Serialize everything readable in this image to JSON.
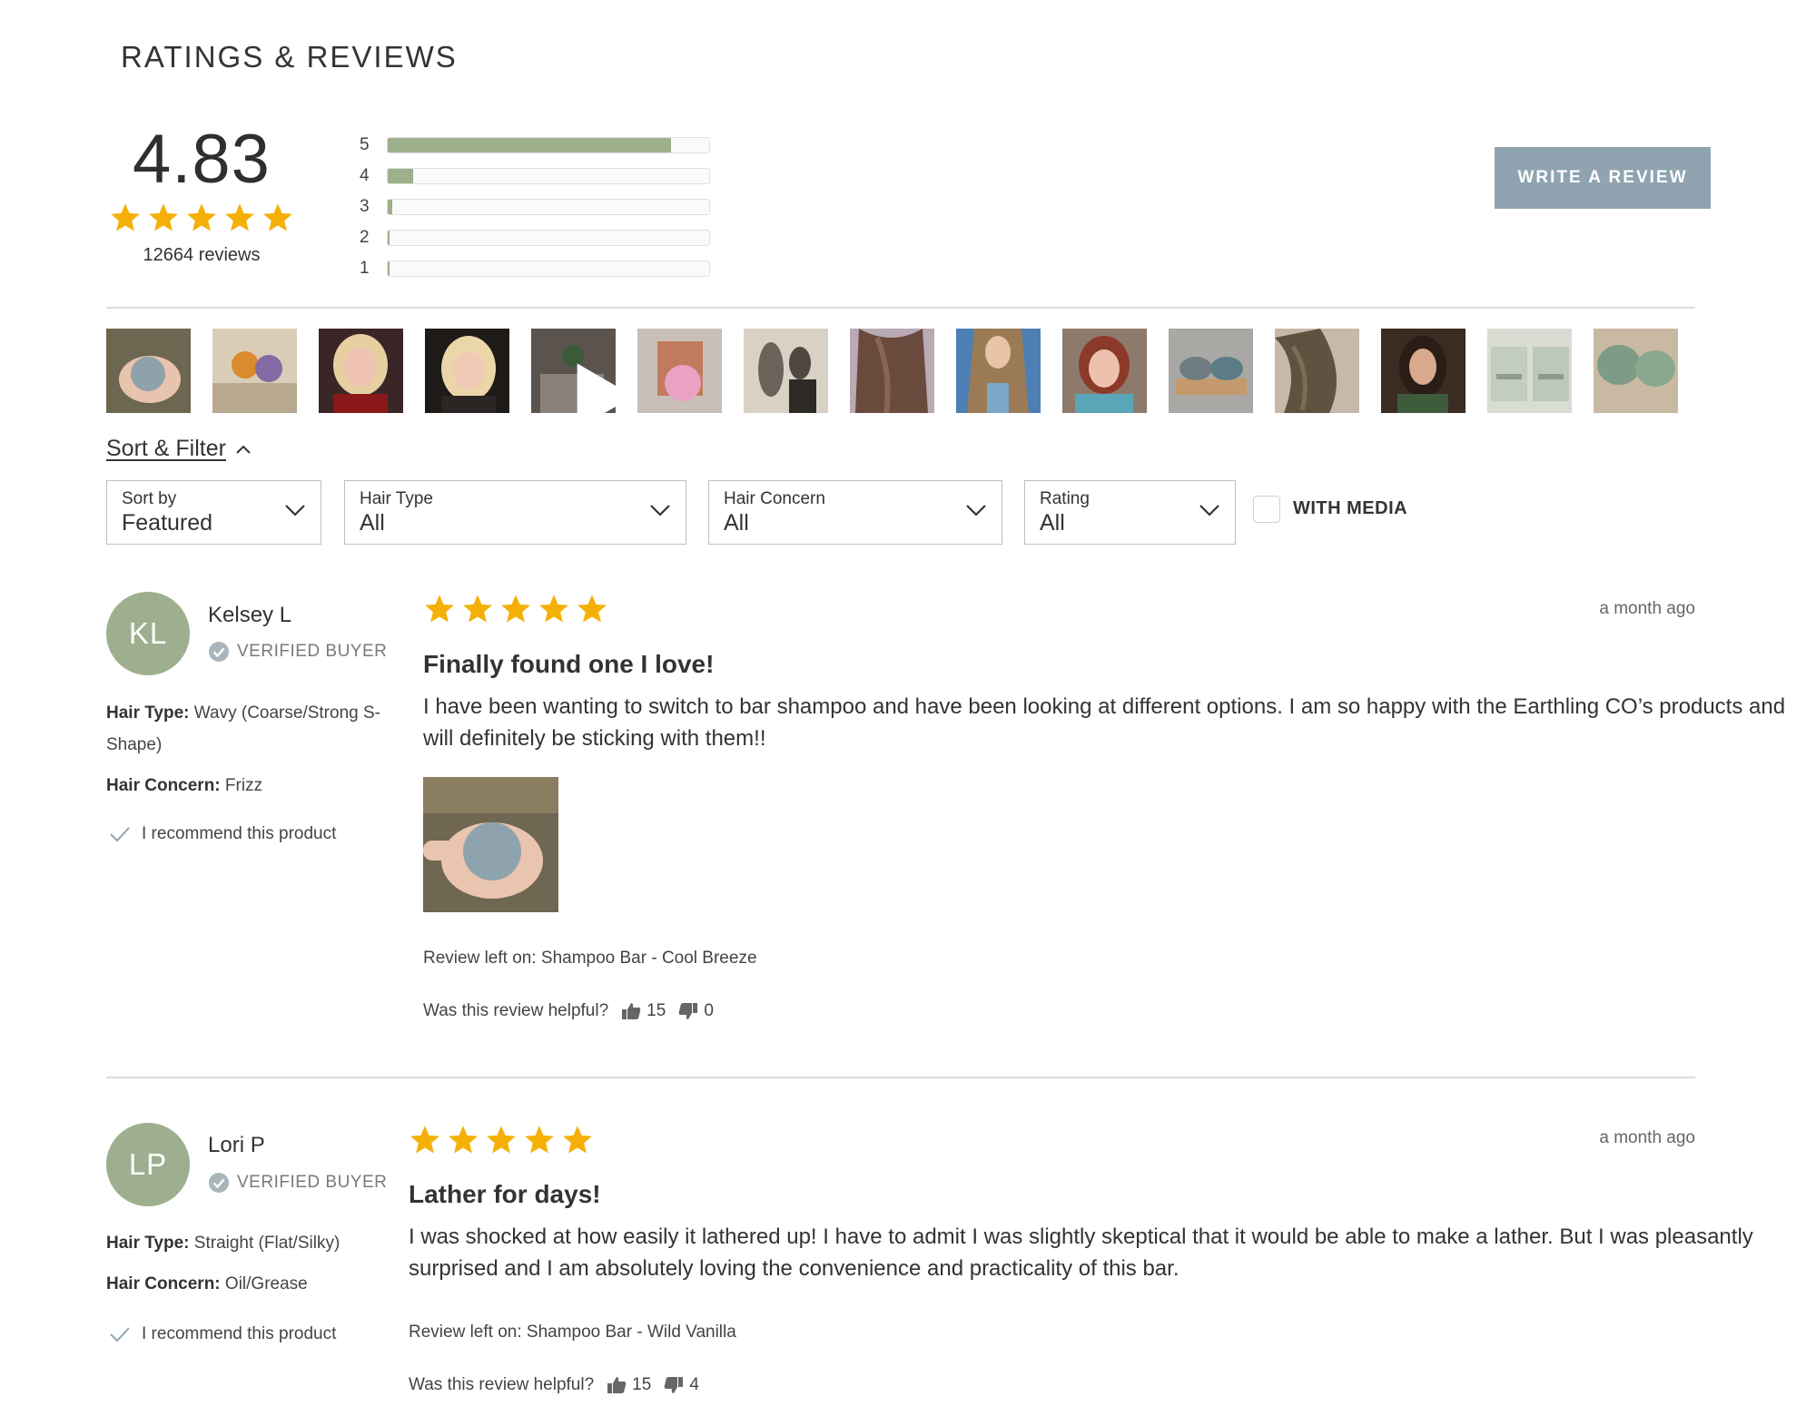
{
  "section_title": "RATINGS & REVIEWS",
  "summary": {
    "average": "4.83",
    "stars": 5,
    "review_count": "12664 reviews",
    "histogram": [
      {
        "label": "5",
        "fraction": 0.88
      },
      {
        "label": "4",
        "fraction": 0.08
      },
      {
        "label": "3",
        "fraction": 0.015
      },
      {
        "label": "2",
        "fraction": 0.006
      },
      {
        "label": "1",
        "fraction": 0.006
      }
    ]
  },
  "write_review_label": "WRITE A REVIEW",
  "media_thumbs": [
    {
      "name": "media-thumb-hand-bar",
      "video": false
    },
    {
      "name": "media-thumb-bars-shelf",
      "video": false
    },
    {
      "name": "media-thumb-blonde-woman",
      "video": false
    },
    {
      "name": "media-thumb-blonde-selfie",
      "video": false
    },
    {
      "name": "media-thumb-video",
      "video": true
    },
    {
      "name": "media-thumb-pink-bar-box",
      "video": false
    },
    {
      "name": "media-thumb-vintage-photo",
      "video": false
    },
    {
      "name": "media-thumb-brown-hair",
      "video": false
    },
    {
      "name": "media-thumb-long-hair",
      "video": false
    },
    {
      "name": "media-thumb-red-hair-woman",
      "video": false
    },
    {
      "name": "media-thumb-bars-dish",
      "video": false
    },
    {
      "name": "media-thumb-wavy-hair",
      "video": false
    },
    {
      "name": "media-thumb-dark-hair-woman",
      "video": false
    },
    {
      "name": "media-thumb-product-boxes",
      "video": false
    },
    {
      "name": "media-thumb-green-bars",
      "video": false
    }
  ],
  "sort_filter_label": "Sort & Filter",
  "filters": [
    {
      "label": "Sort by",
      "value": "Featured"
    },
    {
      "label": "Hair Type",
      "value": "All"
    },
    {
      "label": "Hair Concern",
      "value": "All"
    },
    {
      "label": "Rating",
      "value": "All"
    }
  ],
  "with_media_label": "WITH MEDIA",
  "reviews": [
    {
      "initials": "KL",
      "name": "Kelsey L",
      "verified": "VERIFIED BUYER",
      "hair_type_label": "Hair Type:",
      "hair_type": "Wavy (Coarse/Strong S-Shape)",
      "hair_concern_label": "Hair Concern:",
      "hair_concern": "Frizz",
      "recommend": "I recommend this product",
      "rating": 5,
      "date": "a month ago",
      "title": "Finally found one I love!",
      "body": "I have been wanting to switch to bar shampoo and have been looking at different options. I am so happy with the Earthling CO’s products and will definitely be sticking with them!!",
      "product": "Review left on: Shampoo Bar - Cool Breeze",
      "helpful_label": "Was this review helpful?",
      "up": "15",
      "down": "0"
    },
    {
      "initials": "LP",
      "name": "Lori P",
      "verified": "VERIFIED BUYER",
      "hair_type_label": "Hair Type:",
      "hair_type": "Straight (Flat/Silky)",
      "hair_concern_label": "Hair Concern:",
      "hair_concern": "Oil/Grease",
      "recommend": "I recommend this product",
      "rating": 5,
      "date": "a month ago",
      "title": "Lather for days!",
      "body": "I was shocked at how easily it lathered up! I have to admit I was slightly skeptical that it would be able to make a lather. But I was pleasantly surprised and I am absolutely loving the convenience and practicality of this bar.",
      "product": "Review left on: Shampoo Bar - Wild Vanilla",
      "helpful_label": "Was this review helpful?",
      "up": "15",
      "down": "4"
    }
  ],
  "colors": {
    "star": "#f5b008",
    "histogram_fill": "#9eaf8c",
    "button": "#8fa3b0",
    "avatar": "#9daf8f"
  }
}
